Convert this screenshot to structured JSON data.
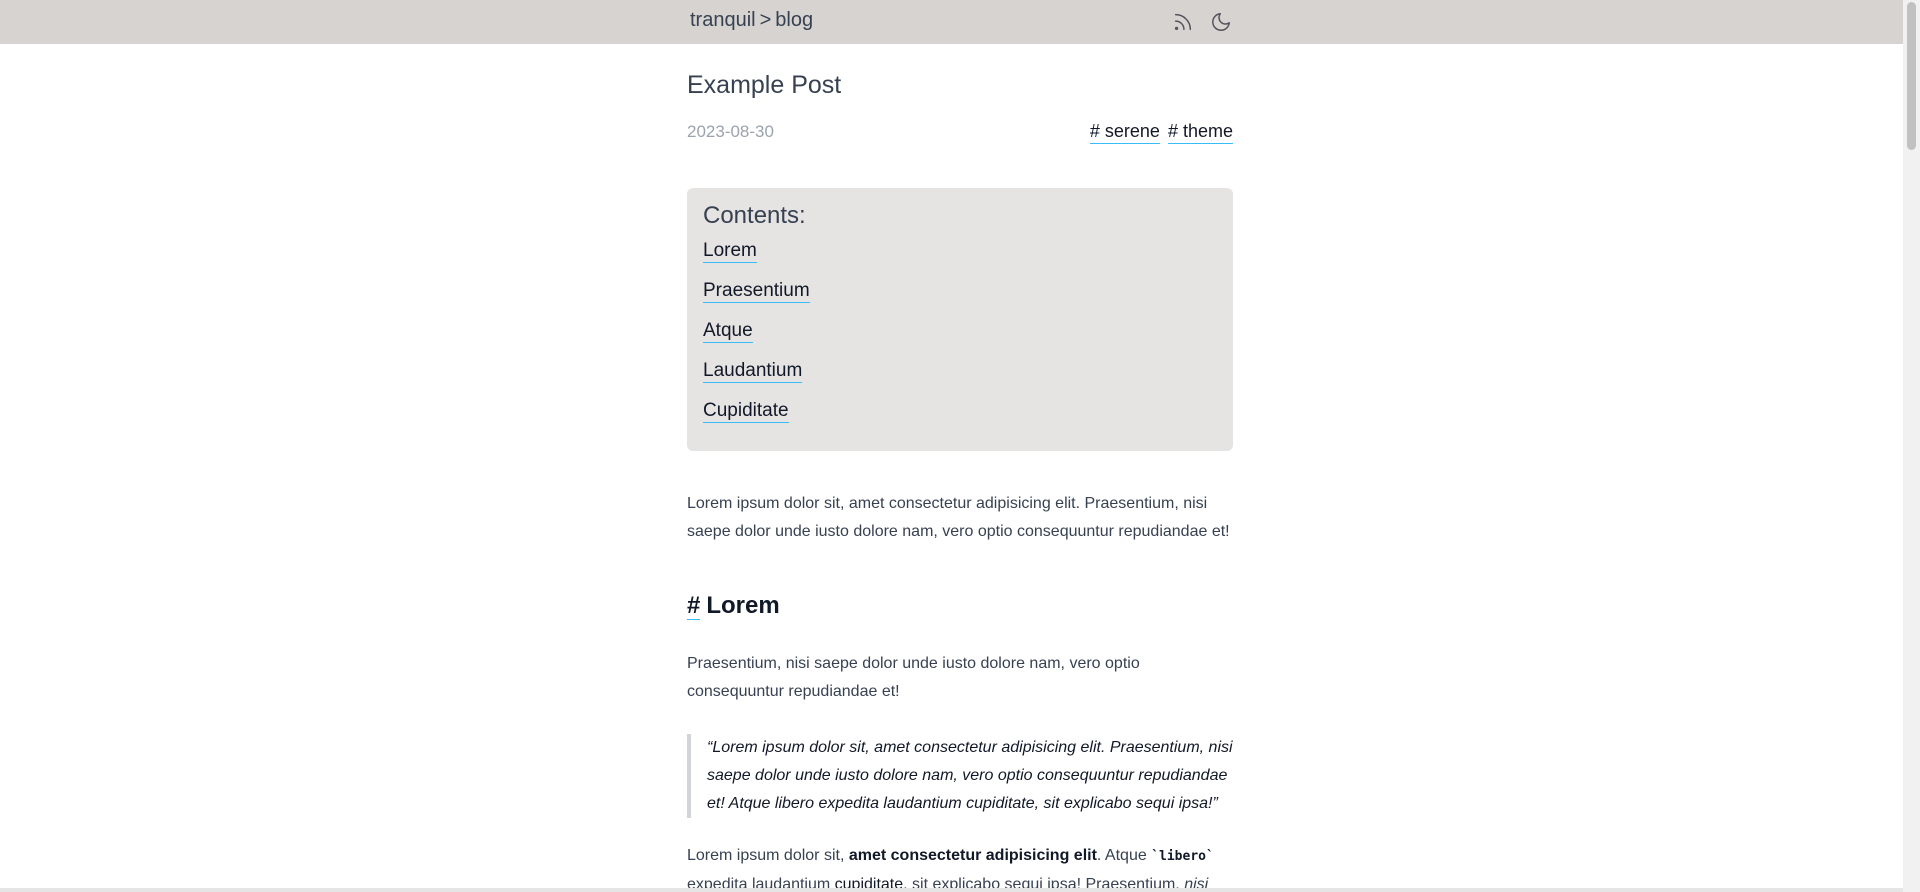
{
  "header": {
    "site": "tranquil",
    "separator": ">",
    "section": "blog",
    "icons": [
      "rss-icon",
      "moon-icon"
    ]
  },
  "post": {
    "title": "Example Post",
    "date": "2023-08-30",
    "tags": [
      "# serene",
      "# theme"
    ]
  },
  "toc": {
    "title": "Contents:",
    "items": [
      "Lorem",
      "Praesentium",
      "Atque",
      "Laudantium",
      "Cupiditate"
    ]
  },
  "body": {
    "intro": "Lorem ipsum dolor sit, amet consectetur adipisicing elit. Praesentium, nisi saepe dolor unde iusto dolore nam, vero optio consequuntur repudiandae et!",
    "section1": {
      "hash": "#",
      "heading": "Lorem",
      "paragraph": "Praesentium, nisi saepe dolor unde iusto dolore nam, vero optio consequuntur repudiandae et!",
      "quote": "“Lorem ipsum dolor sit, amet consectetur adipisicing elit. Praesentium, nisi saepe dolor unde iusto dolore nam, vero optio consequuntur repudiandae et! Atque libero expedita laudantium cupiditate, sit explicabo sequi ipsa!”",
      "p3_a": "Lorem ipsum dolor sit, ",
      "p3_bold": "amet consectetur adipisicing elit",
      "p3_b": ". Atque ",
      "p3_code": "`libero`",
      "p3_c": " expedita laudantium ",
      "p3_strong2": "cupiditate",
      "p3_d": ", sit explicabo sequi ipsa! Praesentium, ",
      "p3_em": "nisi"
    }
  },
  "colors": {
    "topbar": "#d6d3d1",
    "accent_underline": "#38bdf8",
    "toc_bg": "#e5e4e3"
  }
}
